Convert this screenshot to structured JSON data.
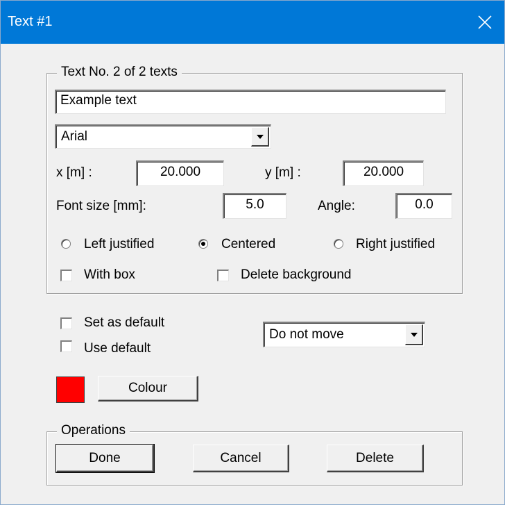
{
  "window": {
    "title": "Text #1"
  },
  "text_group": {
    "legend": "Text  No. 2 of  2 texts",
    "text_value": "Example text",
    "font_value": "Arial",
    "x_label": "x [m] :",
    "x_value": "20.000",
    "y_label": "y [m] :",
    "y_value": "20.000",
    "font_size_label": "Font size [mm]:",
    "font_size_value": "5.0",
    "angle_label": "Angle:",
    "angle_value": "0.0",
    "justify": [
      {
        "label": "Left justified",
        "selected": false
      },
      {
        "label": "Centered",
        "selected": true
      },
      {
        "label": "Right justified",
        "selected": false
      }
    ],
    "with_box_label": "With box",
    "with_box_checked": false,
    "delete_background_label": "Delete background",
    "delete_background_checked": false
  },
  "defaults": {
    "set_default_label": "Set as default",
    "set_default_checked": false,
    "use_default_label": "Use default",
    "use_default_checked": false,
    "move_value": "Do not move"
  },
  "colour": {
    "swatch": "#ff0000",
    "button_label": "Colour"
  },
  "operations": {
    "legend": "Operations",
    "done_label": "Done",
    "cancel_label": "Cancel",
    "delete_label": "Delete"
  },
  "colors": {
    "titlebar": "#0078d7",
    "face": "#f0f0f0"
  },
  "icons": {
    "close": "close-icon",
    "dropdown": "chevron-down-icon"
  }
}
